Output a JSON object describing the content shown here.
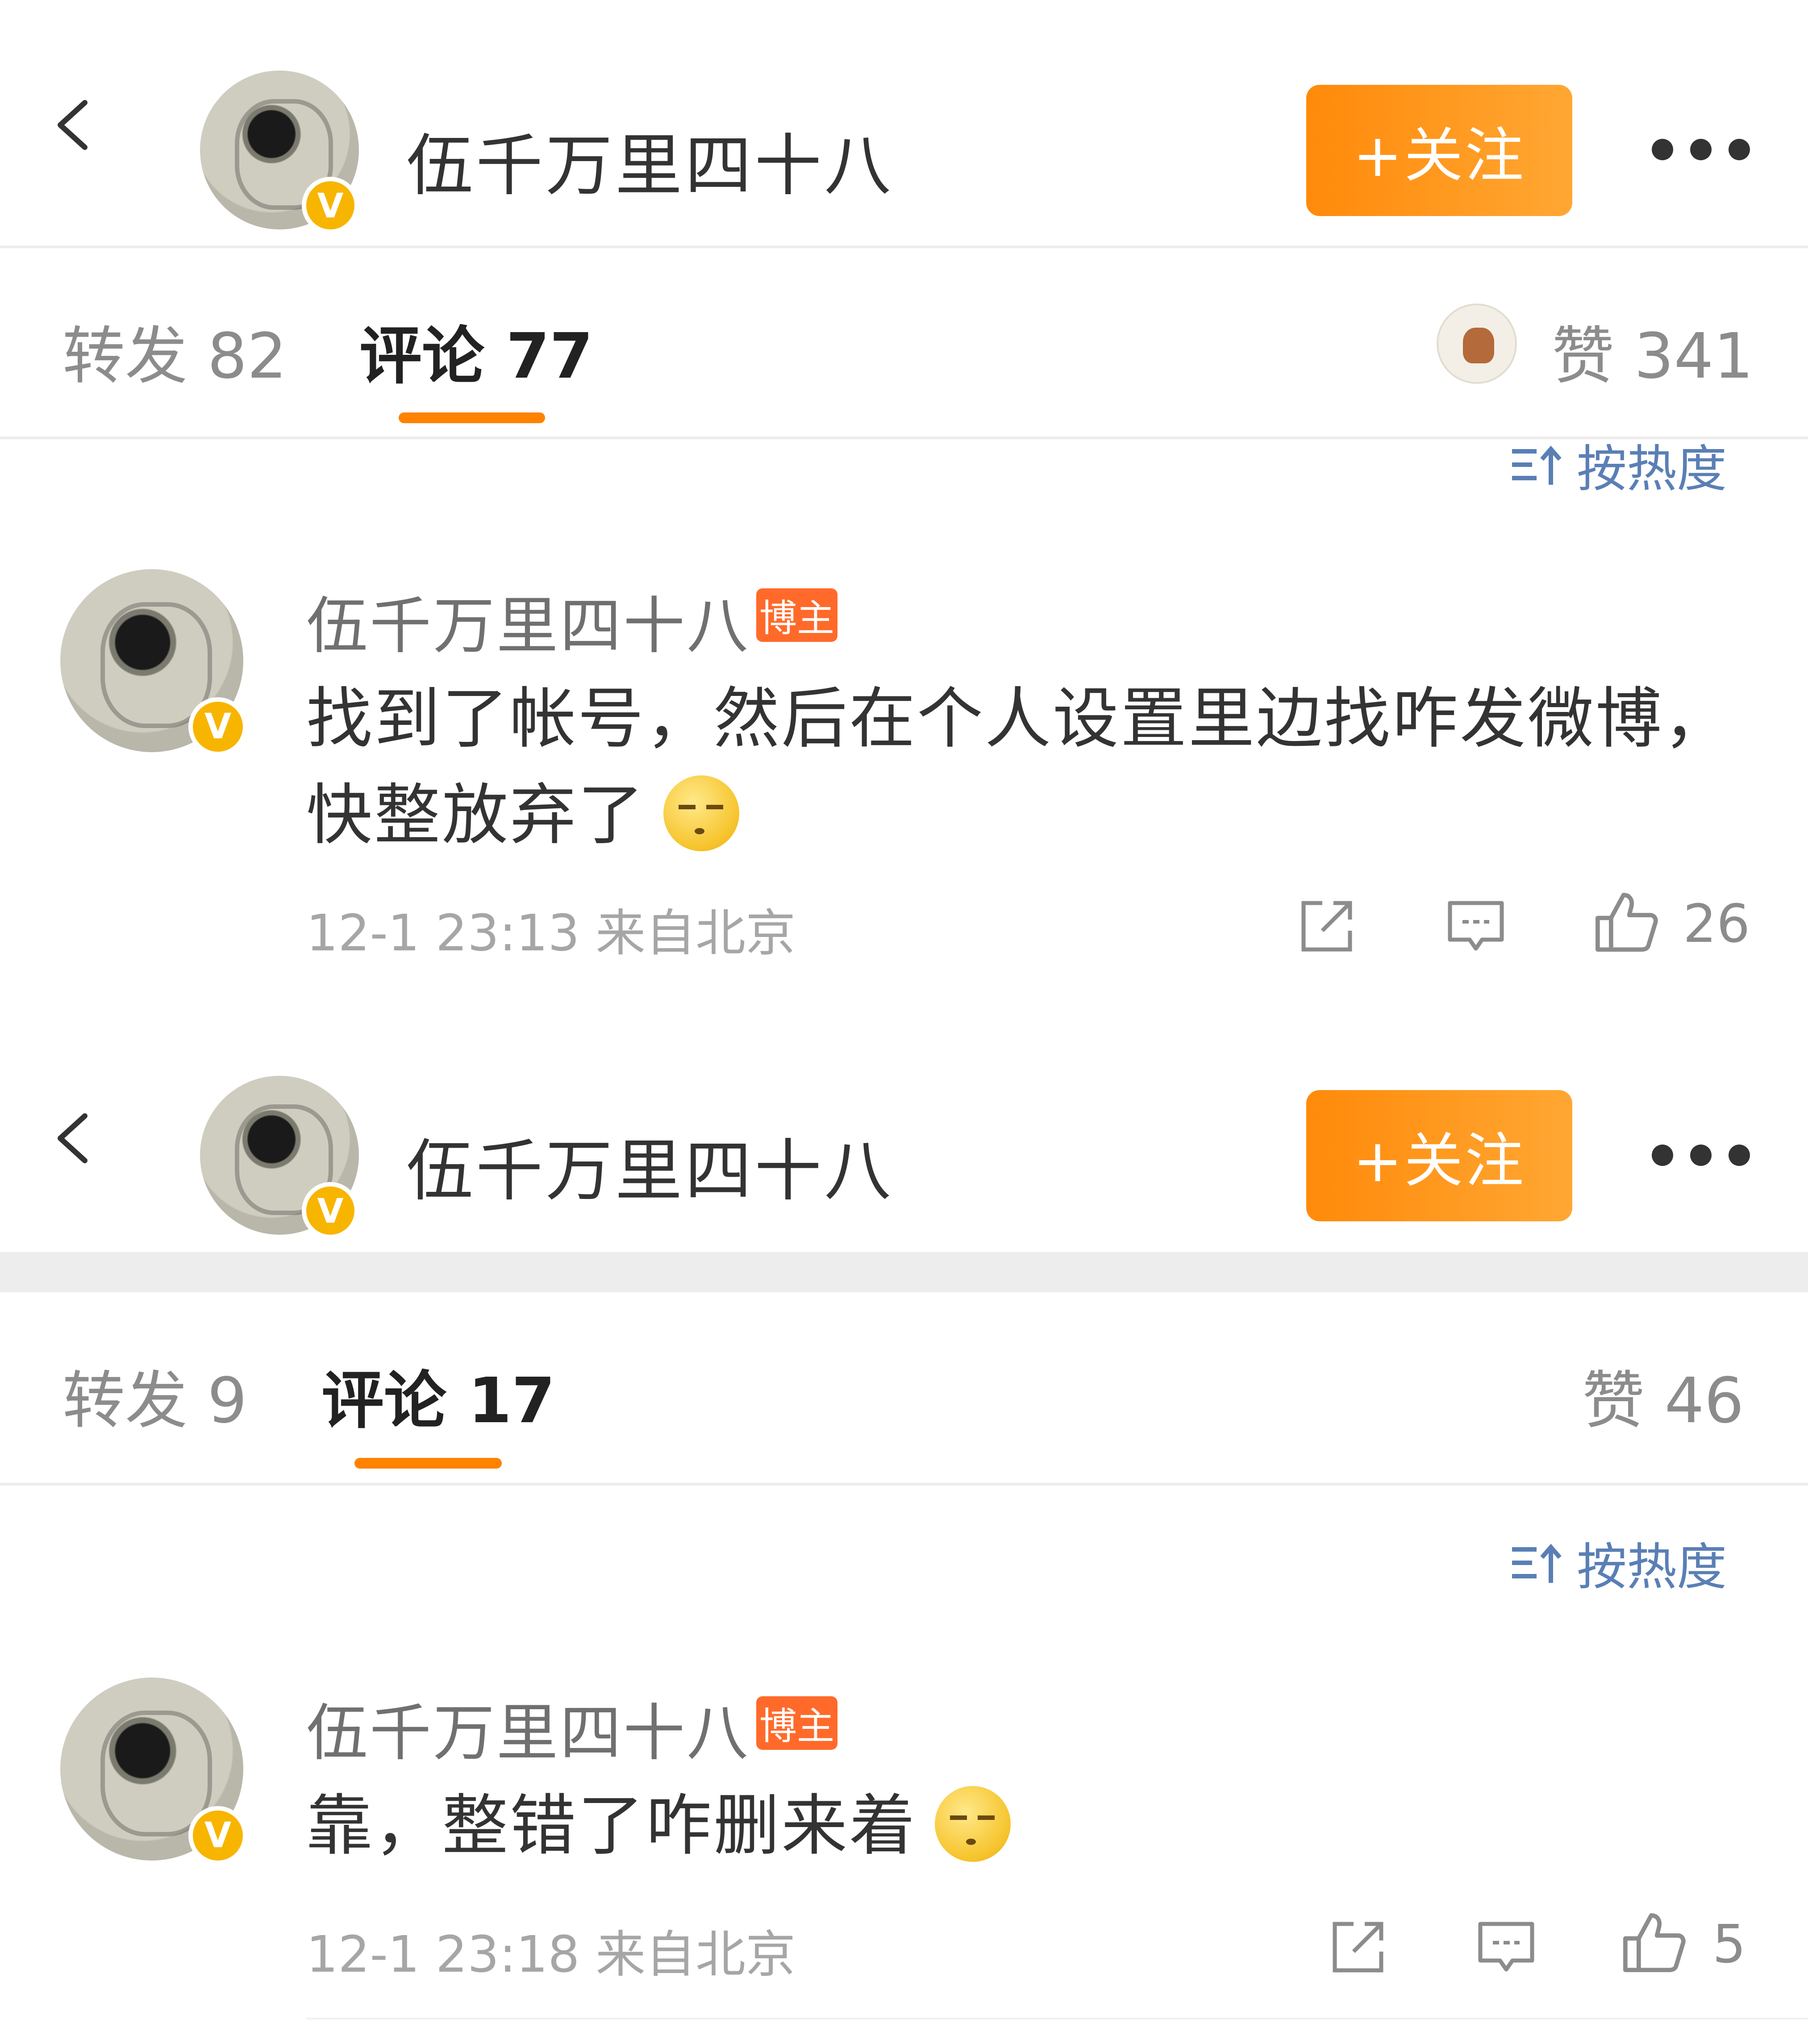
{
  "panels": [
    {
      "header": {
        "back": "back",
        "title": "伍千万里四十八",
        "verified_badge": "V",
        "follow_label": "+关注"
      },
      "tabs": {
        "reposts": "转发 82",
        "comments": "评论 77",
        "likes": "赞 341"
      },
      "sort_label": "按热度",
      "comment": {
        "author": "伍千万里四十八",
        "author_tag": "博主",
        "verified_badge": "V",
        "text_line1": "找到了帐号，然后在个人设置里边找咋发微博，",
        "text_line2": "快整放弃了",
        "emoji": "smirk-emoji",
        "meta": "12-1 23:13  来自北京",
        "like_count": "26"
      }
    },
    {
      "header": {
        "back": "back",
        "title": "伍千万里四十八",
        "verified_badge": "V",
        "follow_label": "+关注"
      },
      "tabs": {
        "reposts": "转发 9",
        "comments": "评论 17",
        "likes": "赞 46"
      },
      "sort_label": "按热度",
      "comment": {
        "author": "伍千万里四十八",
        "author_tag": "博主",
        "verified_badge": "V",
        "text_line1": "靠，整错了咋删来着",
        "emoji": "smirk-emoji",
        "meta": "12-1 23:18  来自北京",
        "like_count": "5"
      }
    }
  ],
  "colors": {
    "accent_orange": "#ff8200",
    "follow_button": "#ff9a1f",
    "sort_blue": "#5a7fb5",
    "verified_gold": "#f7b500",
    "host_tag": "#ff6a2a"
  },
  "icons": [
    "chevron-left-icon",
    "more-dots-icon",
    "sort-icon",
    "share-icon",
    "comment-icon",
    "thumbs-up-icon"
  ]
}
